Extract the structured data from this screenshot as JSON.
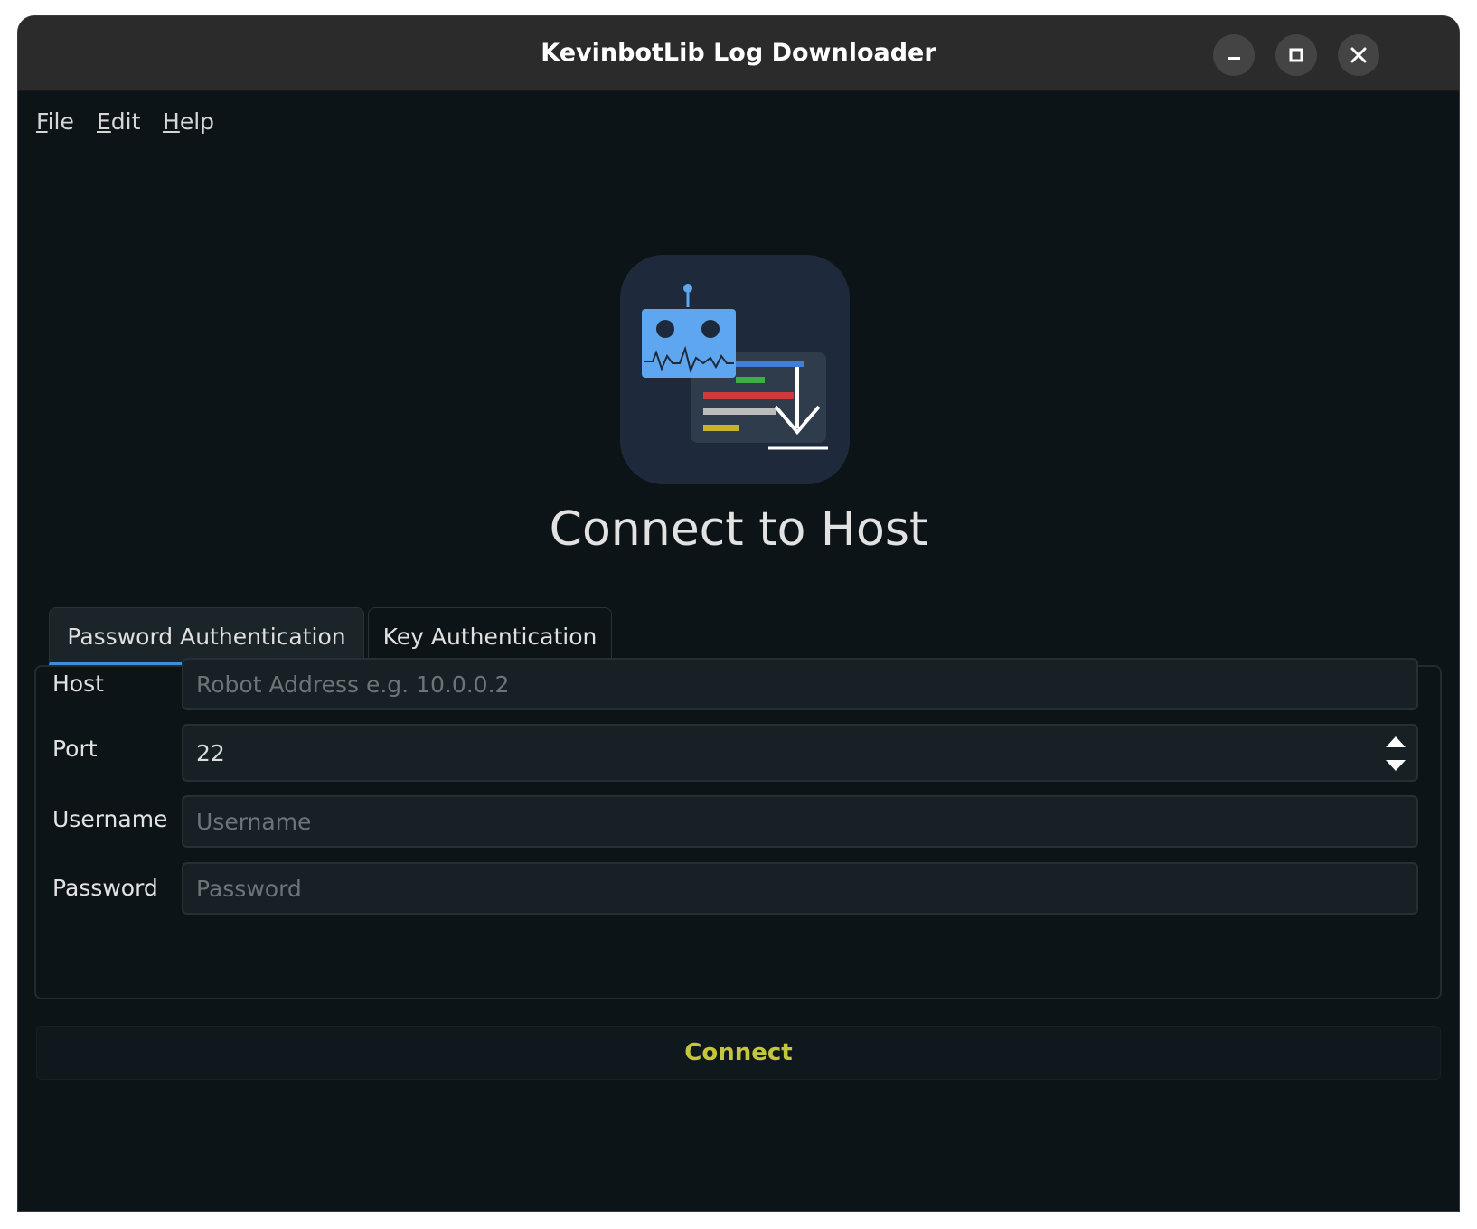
{
  "window": {
    "title": "KevinbotLib Log Downloader"
  },
  "menu": {
    "items": [
      {
        "accel": "F",
        "rest": "ile"
      },
      {
        "accel": "E",
        "rest": "dit"
      },
      {
        "accel": "H",
        "rest": "elp"
      }
    ]
  },
  "main": {
    "heading": "Connect to Host"
  },
  "tabs": [
    {
      "label": "Password Authentication",
      "active": true
    },
    {
      "label": "Key Authentication",
      "active": false
    }
  ],
  "form": {
    "host_label": "Host",
    "host_placeholder": "Robot Address e.g. 10.0.0.2",
    "port_label": "Port",
    "port_value": "22",
    "username_label": "Username",
    "username_placeholder": "Username",
    "password_label": "Password",
    "password_placeholder": "Password"
  },
  "connect_label": "Connect",
  "colors": {
    "accent": "#3f8fd8",
    "connect_text": "#c4c63c",
    "background": "#0d1417"
  },
  "icons": [
    "minimize-icon",
    "maximize-icon",
    "close-icon",
    "app-logo-icon",
    "spin-up-icon",
    "spin-down-icon"
  ]
}
